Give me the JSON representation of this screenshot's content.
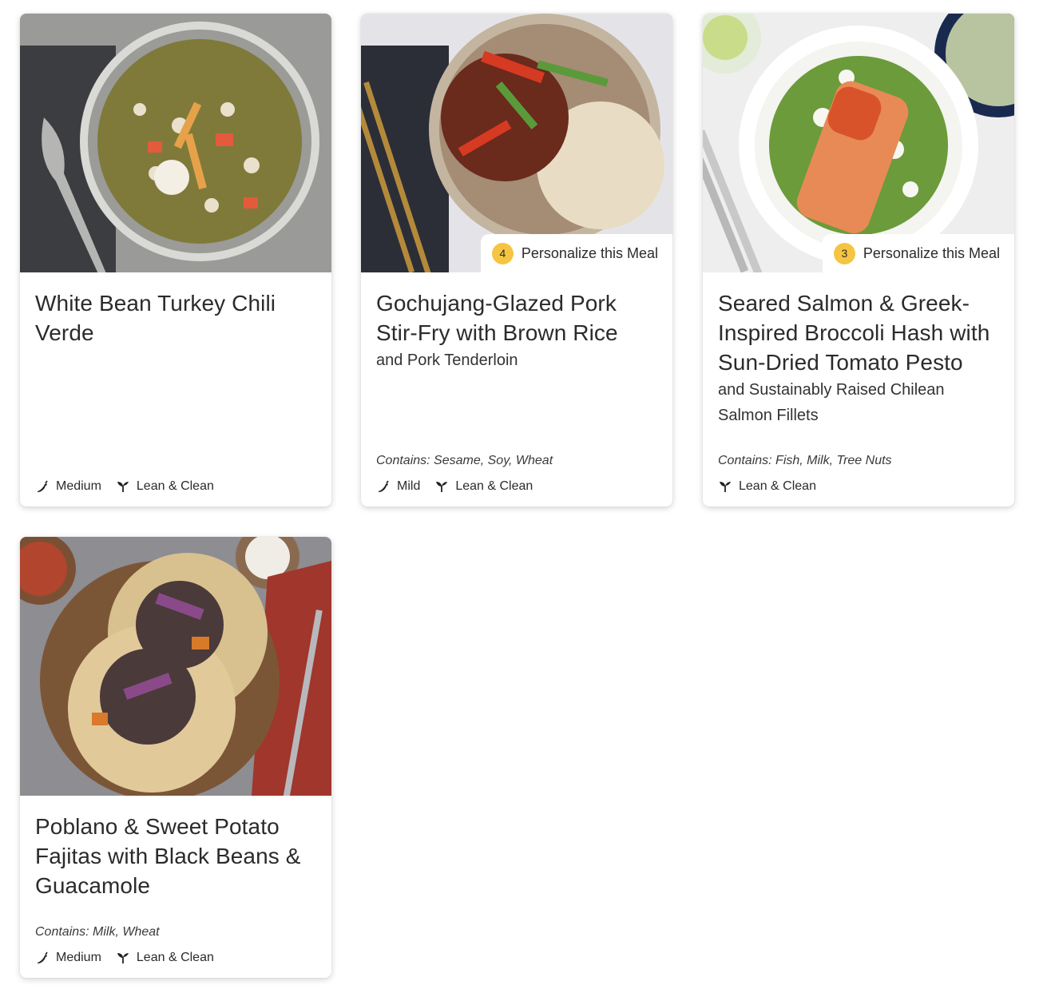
{
  "cards": [
    {
      "title": "White Bean Turkey Chili Verde",
      "subtitle": "",
      "allergens": "",
      "personalize": null,
      "tags": [
        {
          "icon": "pepper-icon",
          "label": "Medium"
        },
        {
          "icon": "sprout-icon",
          "label": "Lean & Clean"
        }
      ]
    },
    {
      "title": "Gochujang-Glazed Pork Stir-Fry with Brown Rice",
      "subtitle": "and Pork Tenderloin",
      "allergens": "Contains: Sesame, Soy, Wheat",
      "personalize": {
        "count": "4",
        "label": "Personalize this Meal"
      },
      "tags": [
        {
          "icon": "pepper-icon",
          "label": "Mild"
        },
        {
          "icon": "sprout-icon",
          "label": "Lean & Clean"
        }
      ]
    },
    {
      "title": "Seared Salmon & Greek-Inspired Broccoli Hash with Sun-Dried Tomato Pesto",
      "subtitle": "and Sustainably Raised Chilean Salmon Fillets",
      "allergens": "Contains: Fish, Milk, Tree Nuts",
      "personalize": {
        "count": "3",
        "label": "Personalize this Meal"
      },
      "tags": [
        {
          "icon": "sprout-icon",
          "label": "Lean & Clean"
        }
      ]
    },
    {
      "title": "Poblano & Sweet Potato Fajitas with Black Beans & Guacamole",
      "subtitle": "",
      "allergens": "Contains: Milk, Wheat",
      "personalize": null,
      "tags": [
        {
          "icon": "pepper-icon",
          "label": "Medium"
        },
        {
          "icon": "sprout-icon",
          "label": "Lean & Clean"
        }
      ]
    }
  ],
  "colors": {
    "badge": "#f5c542",
    "text": "#2b2b2b"
  }
}
